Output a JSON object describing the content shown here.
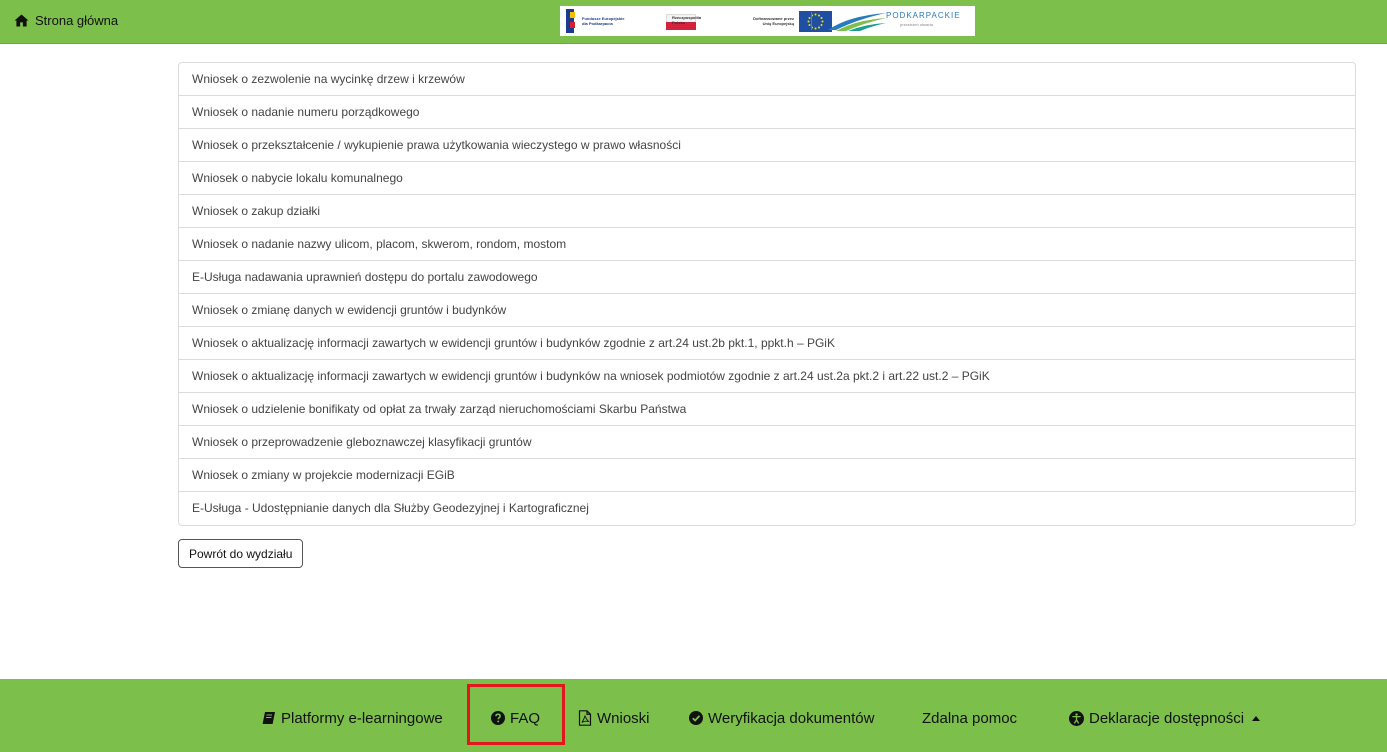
{
  "header": {
    "home_label": "Strona główna",
    "logos": {
      "fe_line1": "Fundusze Europejskie",
      "fe_line2": "dla Podkarpacia",
      "pl_line1": "Rzeczpospolita",
      "pl_line2": "Polska",
      "eu_line1": "Dofinansowane przez",
      "eu_line2": "Unię Europejską",
      "podkarpackie": "PODKARPACKIE",
      "podkarpackie_sub": "przestrzeń otwarta"
    }
  },
  "forms": [
    "Wniosek o zezwolenie na wycinkę drzew i krzewów",
    "Wniosek o nadanie numeru porządkowego",
    "Wniosek o przekształcenie / wykupienie prawa użytkowania wieczystego w prawo własności",
    "Wniosek o nabycie lokalu komunalnego",
    "Wniosek o zakup działki",
    "Wniosek o nadanie nazwy ulicom, placom, skwerom, rondom, mostom",
    "E-Usługa nadawania uprawnień dostępu do portalu zawodowego",
    "Wniosek o zmianę danych w ewidencji gruntów i budynków",
    "Wniosek o aktualizację informacji zawartych w ewidencji gruntów i budynków zgodnie z art.24 ust.2b pkt.1, ppkt.h – PGiK",
    "Wniosek o aktualizację informacji zawartych w ewidencji gruntów i budynków na wniosek podmiotów zgodnie z art.24 ust.2a pkt.2 i art.22 ust.2 – PGiK",
    "Wniosek o udzielenie bonifikaty od opłat za trwały zarząd nieruchomościami Skarbu Państwa",
    "Wniosek o przeprowadzenie gleboznawczej klasyfikacji gruntów",
    "Wniosek o zmiany w projekcie modernizacji EGiB",
    "E-Usługa - Udostępnianie danych dla Służby Geodezyjnej i Kartograficznej"
  ],
  "back_button": "Powrót do wydziału",
  "footer": {
    "elearning": "Platformy e-learningowe",
    "faq": "FAQ",
    "wnioski": "Wnioski",
    "weryfikacja": "Weryfikacja dokumentów",
    "zdalna": "Zdalna pomoc",
    "deklaracje": "Deklaracje dostępności",
    "highlight_color": "#e0181d"
  },
  "colors": {
    "brand_green": "#7cc04b"
  }
}
